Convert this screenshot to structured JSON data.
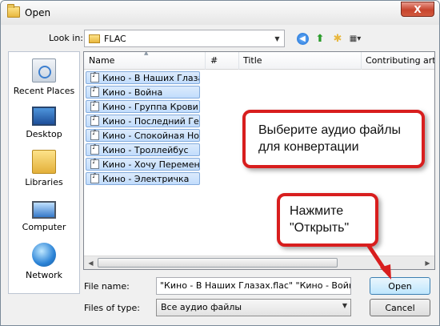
{
  "window": {
    "title": "Open",
    "close_glyph": "X"
  },
  "toolbar": {
    "lookin_label": "Look in:",
    "lookin_value": "FLAC"
  },
  "places": [
    {
      "label": "Recent Places",
      "icon": "recent-places-icon"
    },
    {
      "label": "Desktop",
      "icon": "desktop-icon"
    },
    {
      "label": "Libraries",
      "icon": "libraries-icon"
    },
    {
      "label": "Computer",
      "icon": "computer-icon"
    },
    {
      "label": "Network",
      "icon": "network-icon"
    }
  ],
  "columns": {
    "name": "Name",
    "number": "#",
    "title": "Title",
    "artist": "Contributing art"
  },
  "files": [
    "Кино - В Наших Глазах",
    "Кино - Война",
    "Кино - Группа Крови",
    "Кино - Последний Ге...",
    "Кино - Спокойная Но...",
    "Кино - Троллейбус",
    "Кино - Хочу Перемен",
    "Кино - Электричка"
  ],
  "bottom": {
    "filename_label": "File name:",
    "filename_value": "\"Кино - В Наших Глазах.flac\" \"Кино - Война.f",
    "filetype_label": "Files of type:",
    "filetype_value": "Все аудио файлы",
    "open_label": "Open",
    "cancel_label": "Cancel"
  },
  "callouts": {
    "select_line1": "Выберите аудио файлы",
    "select_line2": "для конвертации",
    "press_line1": "Нажмите",
    "press_line2": "\"Открыть\""
  },
  "colors": {
    "callout_border": "#d81e1e",
    "selection": "#c1dcfc"
  }
}
